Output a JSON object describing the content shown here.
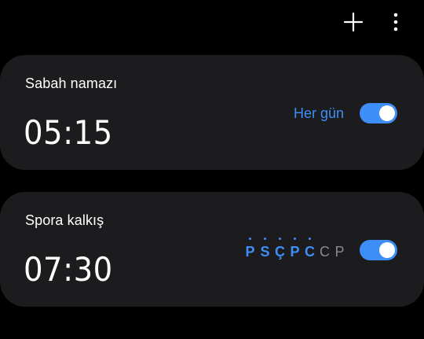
{
  "header": {
    "add_icon": "plus-icon",
    "more_icon": "more-vert-icon"
  },
  "alarms": [
    {
      "name": "Sabah namazı",
      "time": "05:15",
      "repeat_label": "Her gün",
      "enabled": true
    },
    {
      "name": "Spora kalkış",
      "time": "07:30",
      "days": [
        {
          "letter": "P",
          "active": true
        },
        {
          "letter": "S",
          "active": true
        },
        {
          "letter": "Ç",
          "active": true
        },
        {
          "letter": "P",
          "active": true
        },
        {
          "letter": "C",
          "active": true
        },
        {
          "letter": "C",
          "active": false
        },
        {
          "letter": "P",
          "active": false
        }
      ],
      "enabled": true
    }
  ],
  "colors": {
    "background": "#000000",
    "card": "#1c1c1e",
    "accent": "#3e8ef7",
    "inactive_day": "#8a8a8e"
  }
}
